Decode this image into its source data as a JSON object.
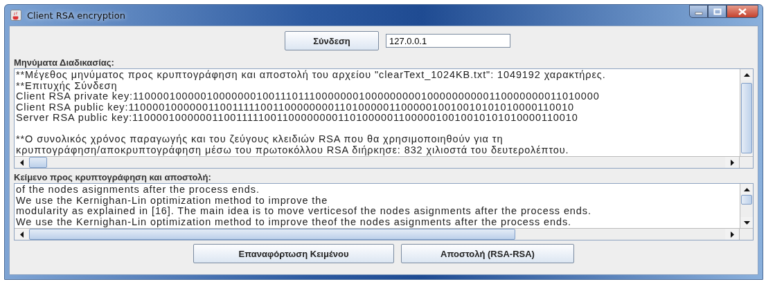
{
  "window": {
    "title": "Client RSA encryption"
  },
  "connection": {
    "button": "Σύνδεση",
    "address": "127.0.0.1"
  },
  "messages": {
    "label": "Μηνύματα Διαδικασίας:",
    "paragraphs": [
      {
        "lines": [
          "**Μέγεθος μηνύματος προς κρυπτογράφηση και αποστολή του αρχείου \"clearText_1024KB.txt\": 1049192 χαρακτήρες.",
          "**Επιτυχής Σύνδεση",
          "Client RSA private key:1100001000001000000010011101110000000100000000010000000000110000000011010000",
          "Client RSA public key:1100001000000110011111001100000000110100000110000010010010101010000110010",
          "Server RSA public key:1100001000000110011111001100000000110100000110000010010010101010000110010"
        ]
      },
      {
        "lines": [
          "**Ο συνολικός χρόνος παραγωγής και του ζεύγους κλειδιών RSA που θα χρησιμοποιηθούν για τη",
          "κρυπτογράφηση/αποκρυπτογράφηση μέσω του πρωτοκόλλου RSA διήρκησε: 832 χιλιοστά του δευτερολέπτου."
        ]
      }
    ]
  },
  "plaintext": {
    "label": "Κείμενο προς κρυπτογράφηση και αποστολή:",
    "paragraphs": [
      {
        "lines": [
          "of the nodes asignments after the process ends.",
          "We use the Kernighan-Lin optimization method to improve the",
          "modularity as explained in [16]. The main idea is to move verticesof the nodes asignments after the process ends.",
          "We use the Kernighan-Lin optimization method to improve theof the nodes asignments after the process ends."
        ]
      }
    ]
  },
  "buttons": [
    "Επαναφόρτωση Κειμένου",
    "Αποστολή (RSA-RSA)"
  ]
}
